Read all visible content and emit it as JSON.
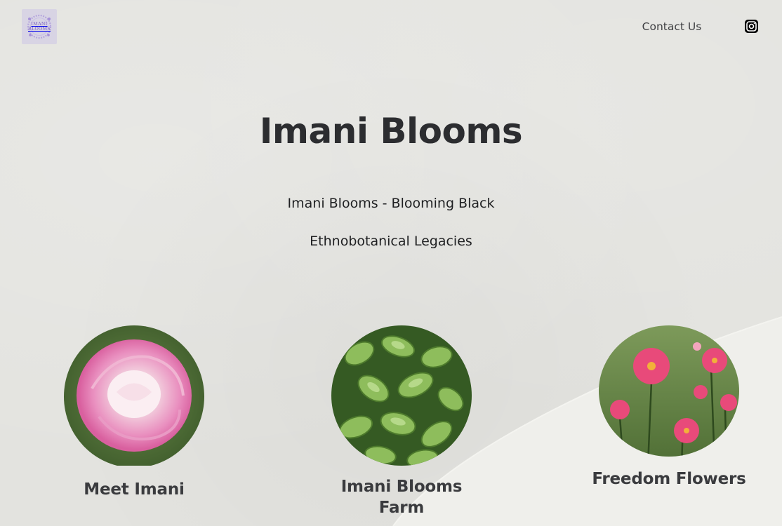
{
  "header": {
    "logo_text_line1": "IMANI",
    "logo_text_line2": "BLOOMS",
    "contact_label": "Contact Us",
    "instagram_icon": "instagram-icon"
  },
  "hero": {
    "title": "Imani Blooms",
    "tagline_line1": "Imani Blooms - Blooming Black",
    "tagline_line2": "Ethnobotanical Legacies"
  },
  "cards": [
    {
      "label": "Meet Imani",
      "image": "pink-rose-photo"
    },
    {
      "label": "Imani Blooms Farm",
      "image": "succulent-plants-photo"
    },
    {
      "label": "Freedom Flowers",
      "image": "pink-dahlias-photo"
    }
  ],
  "colors": {
    "background": "#e3e3df",
    "text": "#2c2d30",
    "logo_accent": "#7a62c2"
  }
}
